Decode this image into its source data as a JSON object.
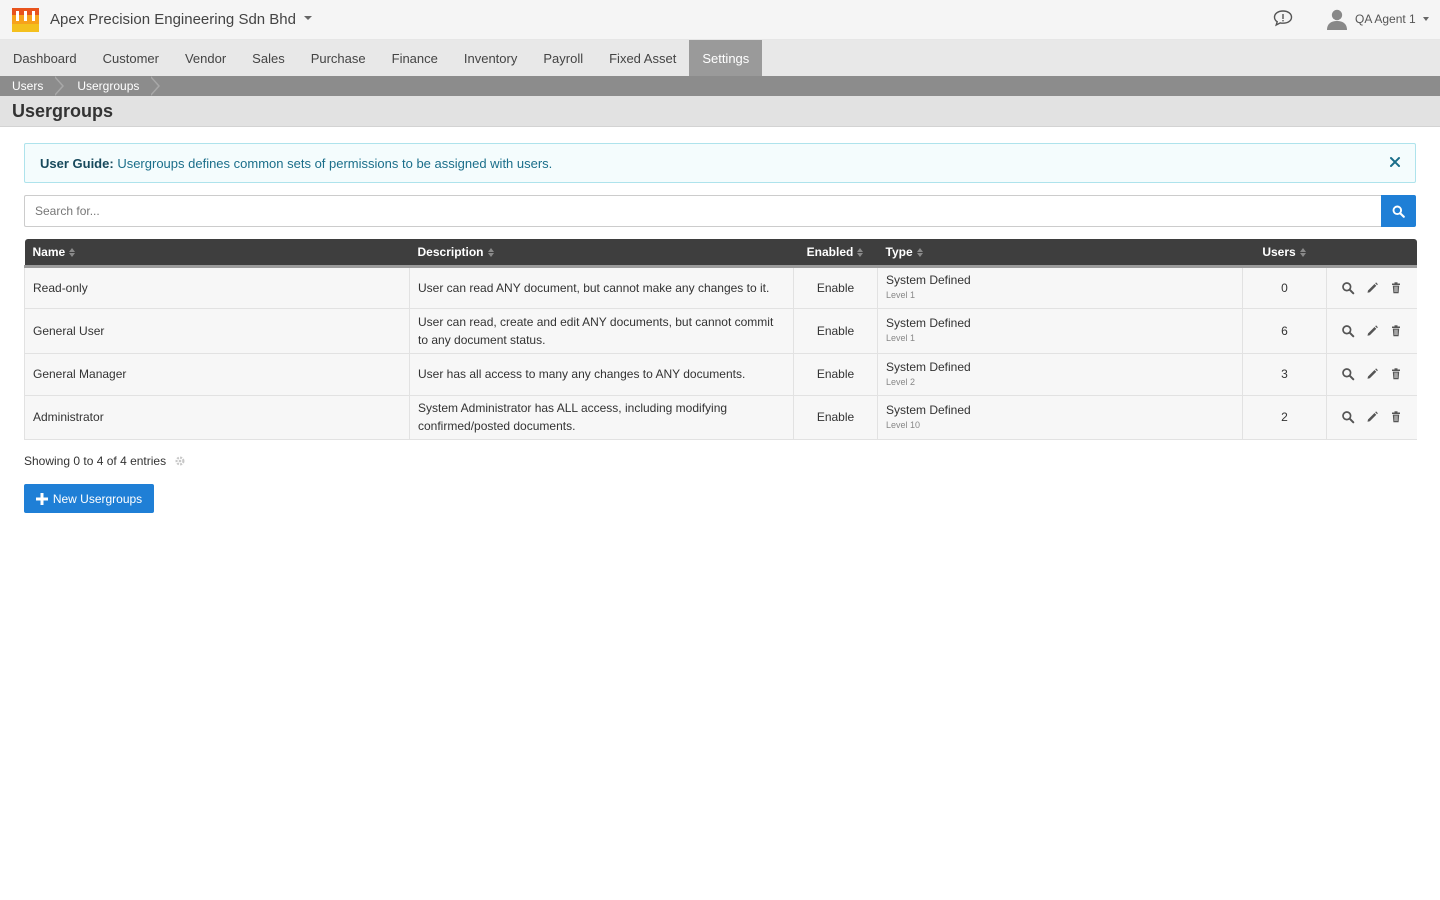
{
  "header": {
    "company_name": "Apex Precision Engineering Sdn Bhd",
    "user_name": "QA Agent 1",
    "icons": [
      "store-logo-icon",
      "chat-icon",
      "user-avatar-icon",
      "caret-down-icon"
    ]
  },
  "nav": {
    "items": [
      {
        "label": "Dashboard"
      },
      {
        "label": "Customer"
      },
      {
        "label": "Vendor"
      },
      {
        "label": "Sales"
      },
      {
        "label": "Purchase"
      },
      {
        "label": "Finance"
      },
      {
        "label": "Inventory"
      },
      {
        "label": "Payroll"
      },
      {
        "label": "Fixed Asset"
      },
      {
        "label": "Settings",
        "active": true
      }
    ]
  },
  "breadcrumb": [
    "Users",
    "Usergroups"
  ],
  "page": {
    "title": "Usergroups"
  },
  "alert": {
    "title": "User Guide:",
    "text": "Usergroups defines common sets of permissions to be assigned with users."
  },
  "search": {
    "placeholder": "Search for...",
    "value": ""
  },
  "table": {
    "columns": {
      "name": "Name",
      "description": "Description",
      "enabled": "Enabled",
      "type": "Type",
      "users": "Users"
    },
    "rows": [
      {
        "name": "Read-only",
        "description": "User can read ANY document, but cannot make any changes to it.",
        "enabled": "Enable",
        "type": "System Defined",
        "level": "Level 1",
        "users": "0"
      },
      {
        "name": "General User",
        "description": "User can read, create and edit ANY documents, but cannot commit to any document status.",
        "enabled": "Enable",
        "type": "System Defined",
        "level": "Level 1",
        "users": "6"
      },
      {
        "name": "General Manager",
        "description": "User has all access to many any changes to ANY documents.",
        "enabled": "Enable",
        "type": "System Defined",
        "level": "Level 2",
        "users": "3"
      },
      {
        "name": "Administrator",
        "description": "System Administrator has ALL access, including modifying confirmed/posted documents.",
        "enabled": "Enable",
        "type": "System Defined",
        "level": "Level 10",
        "users": "2"
      }
    ]
  },
  "footer": {
    "showing": "Showing 0 to 4 of 4 entries",
    "new_button": "New Usergroups"
  },
  "colors": {
    "primary": "#1f7fd6",
    "nav_active": "#9a9a9a",
    "table_header": "#3e3e3e",
    "alert_bg": "#f4fcfd",
    "alert_border": "#aee3ec"
  }
}
